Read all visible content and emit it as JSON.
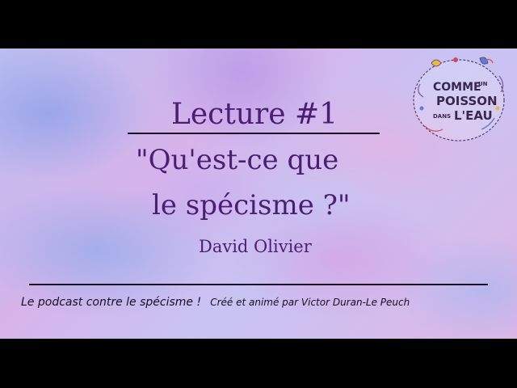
{
  "lecture": {
    "title": "Lecture #1",
    "quote_line1": "\"Qu'est-ce que",
    "quote_line2": "le spécisme ?\"",
    "author": "David Olivier"
  },
  "footer": {
    "tagline": "Le podcast contre le spécisme !",
    "credit": "Créé et animé par Victor Duran-Le Peuch"
  },
  "logo": {
    "line1": "COMME",
    "small1": "UN",
    "line2": "POISSON",
    "small2": "DANS",
    "line3": "L'EAU"
  },
  "colors": {
    "title_text": "#4b1e73",
    "rules": "#1a0d24",
    "frame": "#000000"
  }
}
